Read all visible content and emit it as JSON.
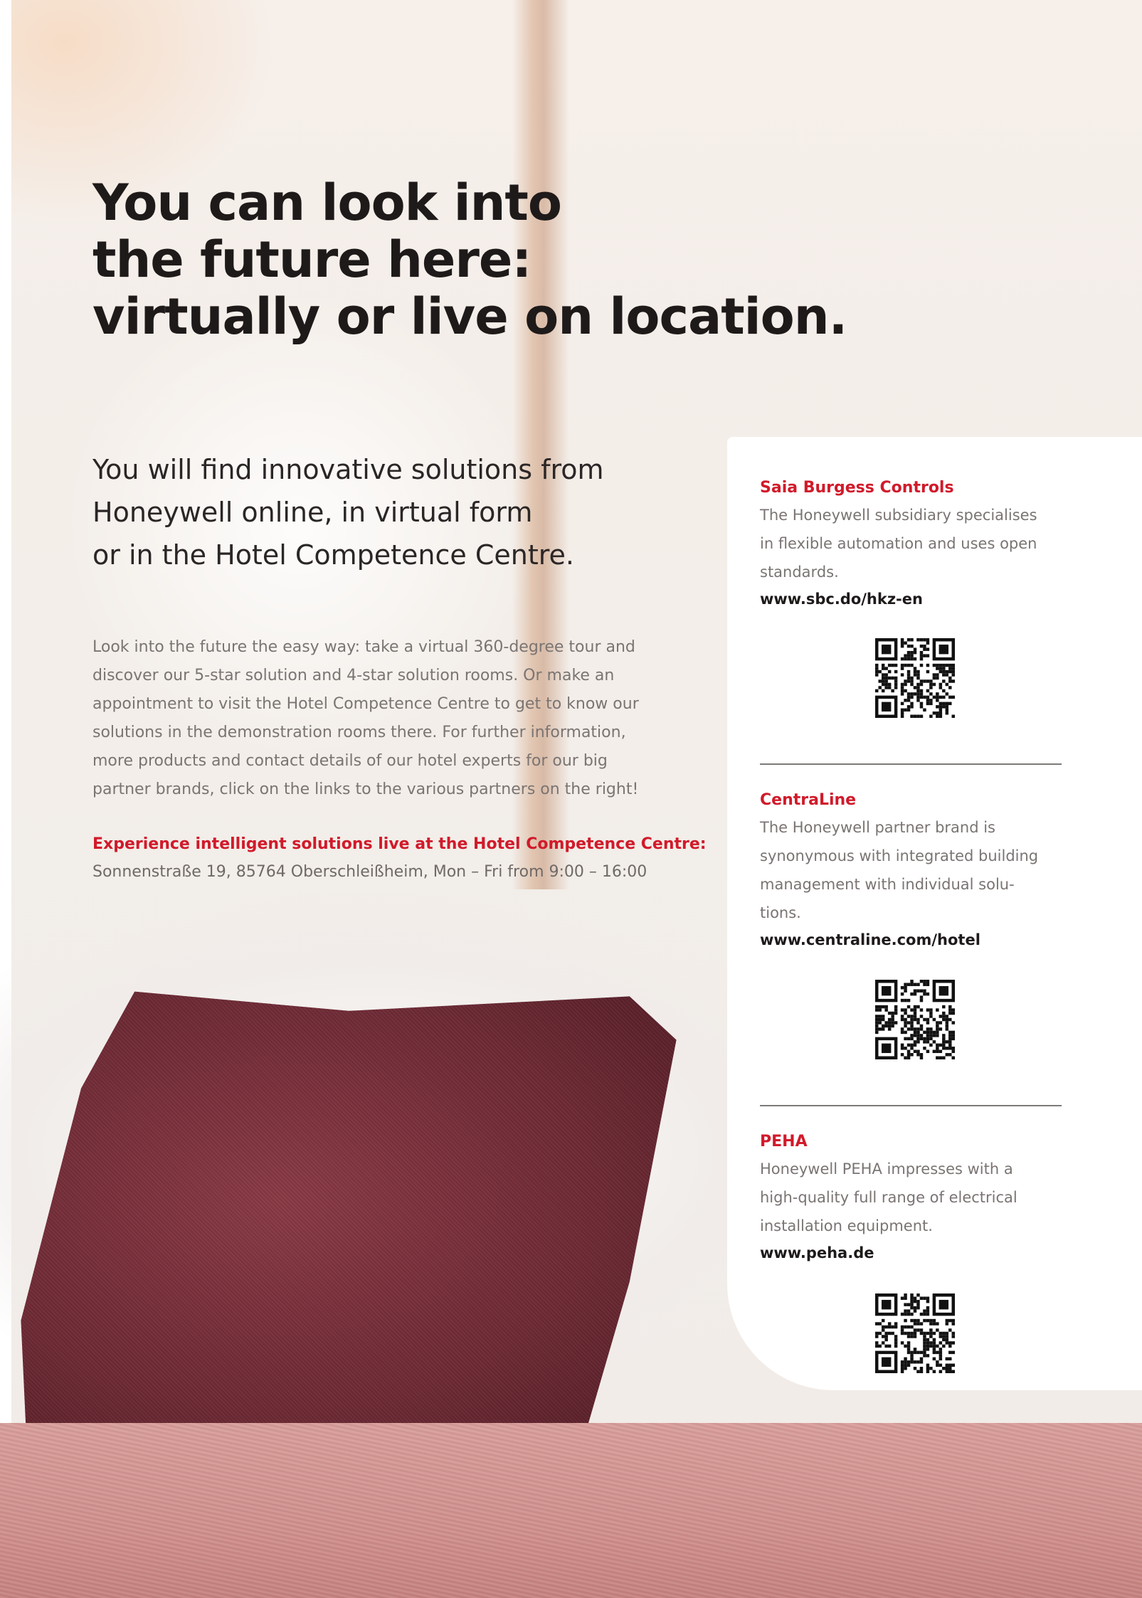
{
  "headline": {
    "line1": "You can look into",
    "line2": "the future here:",
    "line3": "virtually or live on location."
  },
  "subhead": {
    "line1": "You will find innovative solutions from",
    "line2": "Honeywell online, in virtual form",
    "line3": "or in the Hotel Competence Centre."
  },
  "body": {
    "lines": [
      "Look into the future the easy way: take a virtual 360-degree tour and",
      "discover our 5-star solution and 4-star solution rooms. Or make an",
      "appointment to visit the Hotel Competence Centre to get to know our",
      "solutions in the demonstration rooms there. For further information,",
      "more products and contact details of our hotel experts for our big",
      "partner brands, click on the links to the various partners on the right!"
    ]
  },
  "experience": {
    "title": "Experience intelligent solutions live at the Hotel Competence Centre:",
    "address": "Sonnenstraße 19, 85764 Oberschleißheim, Mon – Fri from 9:00 – 16:00"
  },
  "partners": [
    {
      "name": "Saia Burgess Controls",
      "desc_lines": [
        "The Honeywell subsidiary specialises",
        "in flexible automation and uses open",
        "standards."
      ],
      "url": "www.sbc.do/hkz-en",
      "qr_icon": "qr-code-icon"
    },
    {
      "name": "CentraLine",
      "desc_lines": [
        "The Honeywell partner brand is",
        "synonymous with integrated building",
        "management with individual solu-",
        "tions."
      ],
      "url": "www.centraline.com/hotel",
      "qr_icon": "qr-code-icon"
    },
    {
      "name": "PEHA",
      "desc_lines": [
        "Honeywell PEHA impresses with a",
        "high-quality full range of electrical",
        "installation equipment."
      ],
      "url": "www.peha.de",
      "qr_icon": "qr-code-icon"
    }
  ],
  "colors": {
    "accent_red": "#d11a2a",
    "headline": "#1f1a1a",
    "body": "#7a7472",
    "panel": "#ffffff"
  }
}
